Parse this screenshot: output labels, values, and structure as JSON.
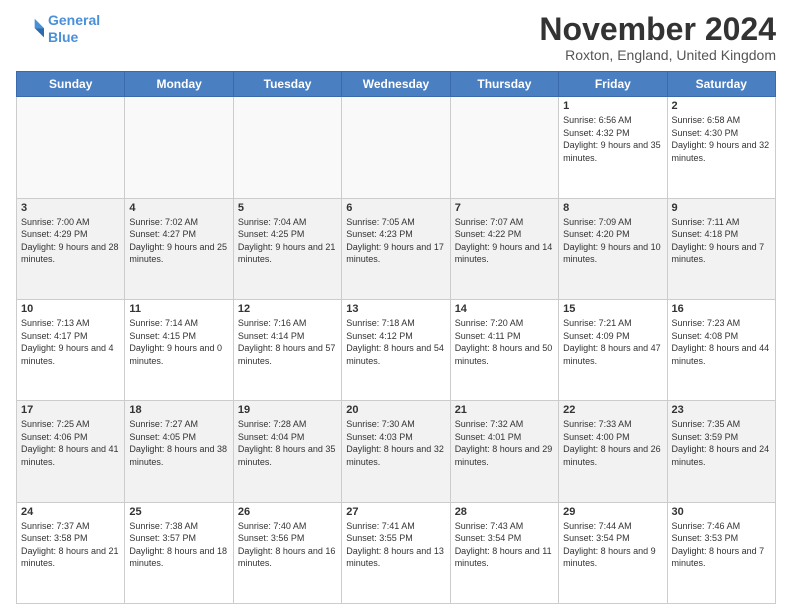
{
  "logo": {
    "line1": "General",
    "line2": "Blue"
  },
  "title": "November 2024",
  "location": "Roxton, England, United Kingdom",
  "days_of_week": [
    "Sunday",
    "Monday",
    "Tuesday",
    "Wednesday",
    "Thursday",
    "Friday",
    "Saturday"
  ],
  "weeks": [
    [
      {
        "day": "",
        "info": ""
      },
      {
        "day": "",
        "info": ""
      },
      {
        "day": "",
        "info": ""
      },
      {
        "day": "",
        "info": ""
      },
      {
        "day": "",
        "info": ""
      },
      {
        "day": "1",
        "info": "Sunrise: 6:56 AM\nSunset: 4:32 PM\nDaylight: 9 hours\nand 35 minutes."
      },
      {
        "day": "2",
        "info": "Sunrise: 6:58 AM\nSunset: 4:30 PM\nDaylight: 9 hours\nand 32 minutes."
      }
    ],
    [
      {
        "day": "3",
        "info": "Sunrise: 7:00 AM\nSunset: 4:29 PM\nDaylight: 9 hours\nand 28 minutes."
      },
      {
        "day": "4",
        "info": "Sunrise: 7:02 AM\nSunset: 4:27 PM\nDaylight: 9 hours\nand 25 minutes."
      },
      {
        "day": "5",
        "info": "Sunrise: 7:04 AM\nSunset: 4:25 PM\nDaylight: 9 hours\nand 21 minutes."
      },
      {
        "day": "6",
        "info": "Sunrise: 7:05 AM\nSunset: 4:23 PM\nDaylight: 9 hours\nand 17 minutes."
      },
      {
        "day": "7",
        "info": "Sunrise: 7:07 AM\nSunset: 4:22 PM\nDaylight: 9 hours\nand 14 minutes."
      },
      {
        "day": "8",
        "info": "Sunrise: 7:09 AM\nSunset: 4:20 PM\nDaylight: 9 hours\nand 10 minutes."
      },
      {
        "day": "9",
        "info": "Sunrise: 7:11 AM\nSunset: 4:18 PM\nDaylight: 9 hours\nand 7 minutes."
      }
    ],
    [
      {
        "day": "10",
        "info": "Sunrise: 7:13 AM\nSunset: 4:17 PM\nDaylight: 9 hours\nand 4 minutes."
      },
      {
        "day": "11",
        "info": "Sunrise: 7:14 AM\nSunset: 4:15 PM\nDaylight: 9 hours\nand 0 minutes."
      },
      {
        "day": "12",
        "info": "Sunrise: 7:16 AM\nSunset: 4:14 PM\nDaylight: 8 hours\nand 57 minutes."
      },
      {
        "day": "13",
        "info": "Sunrise: 7:18 AM\nSunset: 4:12 PM\nDaylight: 8 hours\nand 54 minutes."
      },
      {
        "day": "14",
        "info": "Sunrise: 7:20 AM\nSunset: 4:11 PM\nDaylight: 8 hours\nand 50 minutes."
      },
      {
        "day": "15",
        "info": "Sunrise: 7:21 AM\nSunset: 4:09 PM\nDaylight: 8 hours\nand 47 minutes."
      },
      {
        "day": "16",
        "info": "Sunrise: 7:23 AM\nSunset: 4:08 PM\nDaylight: 8 hours\nand 44 minutes."
      }
    ],
    [
      {
        "day": "17",
        "info": "Sunrise: 7:25 AM\nSunset: 4:06 PM\nDaylight: 8 hours\nand 41 minutes."
      },
      {
        "day": "18",
        "info": "Sunrise: 7:27 AM\nSunset: 4:05 PM\nDaylight: 8 hours\nand 38 minutes."
      },
      {
        "day": "19",
        "info": "Sunrise: 7:28 AM\nSunset: 4:04 PM\nDaylight: 8 hours\nand 35 minutes."
      },
      {
        "day": "20",
        "info": "Sunrise: 7:30 AM\nSunset: 4:03 PM\nDaylight: 8 hours\nand 32 minutes."
      },
      {
        "day": "21",
        "info": "Sunrise: 7:32 AM\nSunset: 4:01 PM\nDaylight: 8 hours\nand 29 minutes."
      },
      {
        "day": "22",
        "info": "Sunrise: 7:33 AM\nSunset: 4:00 PM\nDaylight: 8 hours\nand 26 minutes."
      },
      {
        "day": "23",
        "info": "Sunrise: 7:35 AM\nSunset: 3:59 PM\nDaylight: 8 hours\nand 24 minutes."
      }
    ],
    [
      {
        "day": "24",
        "info": "Sunrise: 7:37 AM\nSunset: 3:58 PM\nDaylight: 8 hours\nand 21 minutes."
      },
      {
        "day": "25",
        "info": "Sunrise: 7:38 AM\nSunset: 3:57 PM\nDaylight: 8 hours\nand 18 minutes."
      },
      {
        "day": "26",
        "info": "Sunrise: 7:40 AM\nSunset: 3:56 PM\nDaylight: 8 hours\nand 16 minutes."
      },
      {
        "day": "27",
        "info": "Sunrise: 7:41 AM\nSunset: 3:55 PM\nDaylight: 8 hours\nand 13 minutes."
      },
      {
        "day": "28",
        "info": "Sunrise: 7:43 AM\nSunset: 3:54 PM\nDaylight: 8 hours\nand 11 minutes."
      },
      {
        "day": "29",
        "info": "Sunrise: 7:44 AM\nSunset: 3:54 PM\nDaylight: 8 hours\nand 9 minutes."
      },
      {
        "day": "30",
        "info": "Sunrise: 7:46 AM\nSunset: 3:53 PM\nDaylight: 8 hours\nand 7 minutes."
      }
    ]
  ]
}
